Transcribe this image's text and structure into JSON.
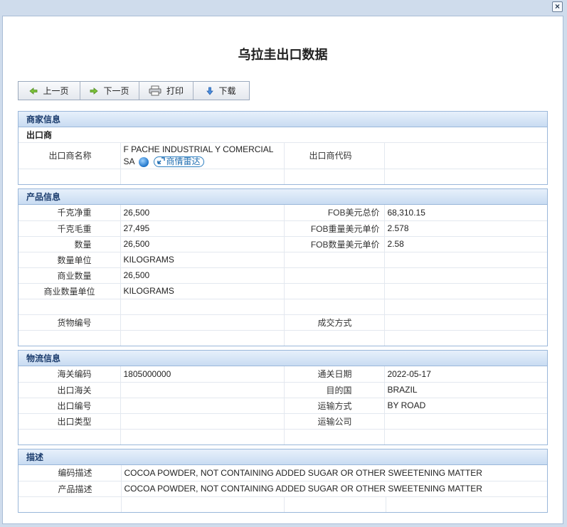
{
  "window": {
    "close_label": "×"
  },
  "page": {
    "title": "乌拉圭出口数据"
  },
  "toolbar": {
    "prev": "上一页",
    "next": "下一页",
    "print": "打印",
    "download": "下载"
  },
  "merchant": {
    "heading": "商家信息",
    "sub_heading": "出口商",
    "name_label": "出口商名称",
    "name_line1": "F PACHE INDUSTRIAL Y COMERCIAL",
    "name_line2": "SA",
    "radar_label": "商情雷达",
    "code_label": "出口商代码",
    "code_value": ""
  },
  "product": {
    "heading": "产品信息",
    "rows": [
      {
        "l1": "千克净重",
        "v1": "26,500",
        "l2": "FOB美元总价",
        "v2": "68,310.15"
      },
      {
        "l1": "千克毛重",
        "v1": "27,495",
        "l2": "FOB重量美元单价",
        "v2": "2.578"
      },
      {
        "l1": "数量",
        "v1": "26,500",
        "l2": "FOB数量美元单价",
        "v2": "2.58"
      },
      {
        "l1": "数量单位",
        "v1": "KILOGRAMS",
        "l2": "",
        "v2": ""
      },
      {
        "l1": "商业数量",
        "v1": "26,500",
        "l2": "",
        "v2": ""
      },
      {
        "l1": "商业数量单位",
        "v1": "KILOGRAMS",
        "l2": "",
        "v2": ""
      },
      {
        "l1": "",
        "v1": "",
        "l2": "",
        "v2": ""
      },
      {
        "l1": "货物编号",
        "v1": "",
        "l2": "成交方式",
        "v2": ""
      },
      {
        "l1": "",
        "v1": "",
        "l2": "",
        "v2": ""
      }
    ]
  },
  "logistics": {
    "heading": "物流信息",
    "rows": [
      {
        "l1": "海关编码",
        "v1": "1805000000",
        "l2": "通关日期",
        "v2": "2022-05-17"
      },
      {
        "l1": "出口海关",
        "v1": "",
        "l2": "目的国",
        "v2": "BRAZIL"
      },
      {
        "l1": "出口编号",
        "v1": "",
        "l2": "运输方式",
        "v2": "BY ROAD"
      },
      {
        "l1": "出口类型",
        "v1": "",
        "l2": "运输公司",
        "v2": ""
      },
      {
        "l1": "",
        "v1": "",
        "l2": "",
        "v2": ""
      }
    ]
  },
  "description": {
    "heading": "描述",
    "code_desc_label": "编码描述",
    "code_desc_value": "COCOA POWDER, NOT CONTAINING ADDED SUGAR OR OTHER SWEETENING MATTER",
    "product_desc_label": "产品描述",
    "product_desc_value": "COCOA POWDER, NOT CONTAINING ADDED SUGAR OR OTHER SWEETENING MATTER"
  }
}
